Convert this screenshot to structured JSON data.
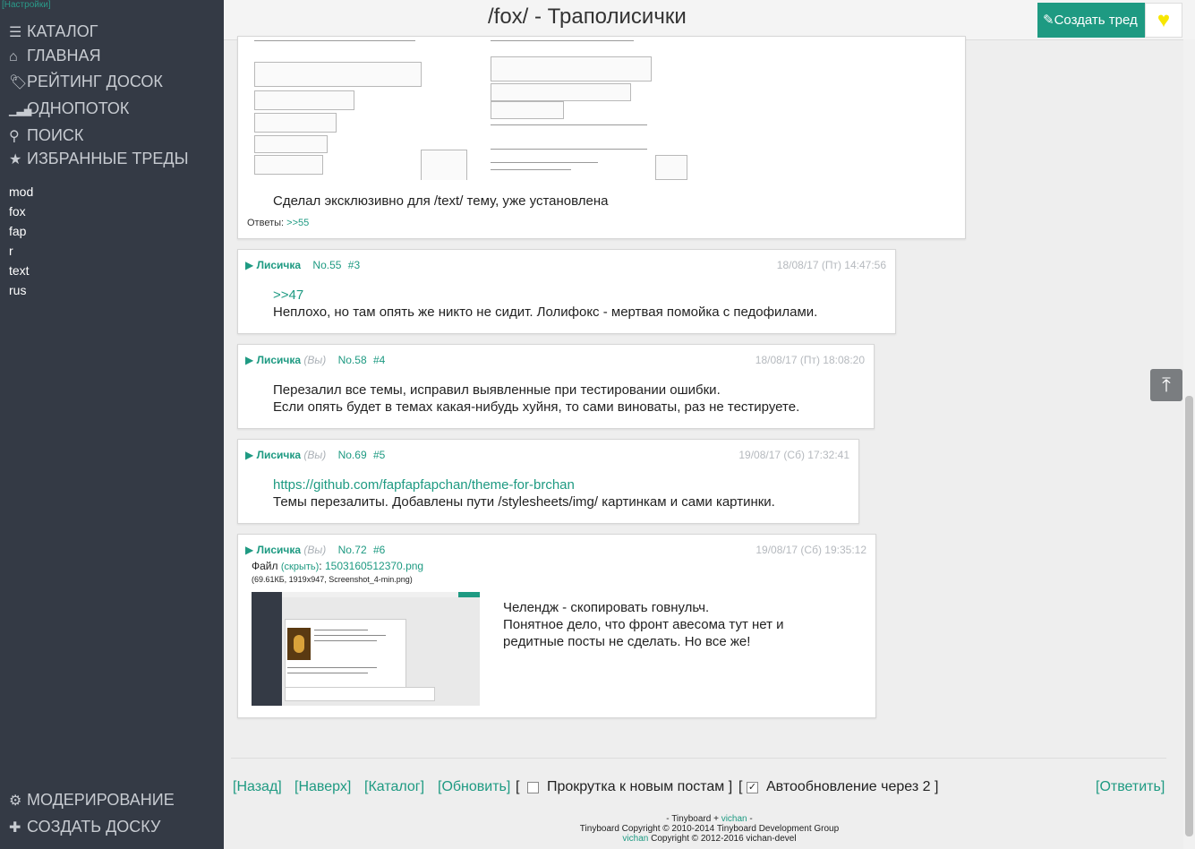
{
  "settings_link": "[Настройки]",
  "sidebar": {
    "nav": [
      {
        "icon": "☰",
        "label": "КАТАЛОГ"
      },
      {
        "icon": "⌂",
        "label": "ГЛАВНАЯ"
      },
      {
        "icon": "🏷",
        "label": "РЕЙТИНГ ДОСОК"
      },
      {
        "icon": "▁▃▅",
        "label": "ОДНОПОТОК"
      },
      {
        "icon": "⚲",
        "label": "ПОИСК"
      },
      {
        "icon": "★",
        "label": "ИЗБРАННЫЕ ТРЕДЫ"
      }
    ],
    "boards": [
      "mod",
      "fox",
      "fap",
      "r",
      "text",
      "rus"
    ],
    "bottom": [
      {
        "icon": "⚙",
        "label": "МОДЕРИРОВАНИЕ"
      },
      {
        "icon": "✚",
        "label": "СОЗДАТЬ ДОСКУ"
      }
    ]
  },
  "header": {
    "title": "/fox/ - Траполисички",
    "create_thread": "✎Создать тред",
    "fav_icon": "♥"
  },
  "posts": [
    {
      "text": "Сделал эксклюзивно для /text/ тему, уже установлена",
      "replies_label": "Ответы:",
      "replies_link": ">>55"
    },
    {
      "name": "Лисичка",
      "you": "",
      "no": "No.55",
      "num": "#3",
      "date": "18/08/17 (Пт) 14:47:56",
      "lines": [
        ">>47",
        "Неплохо, но там опять же никто не сидит. Лолифокс - мертвая помойка с педофилами."
      ]
    },
    {
      "name": "Лисичка",
      "you": "(Вы)",
      "no": "No.58",
      "num": "#4",
      "date": "18/08/17 (Пт) 18:08:20",
      "lines": [
        "Перезалил все темы, исправил выявленные при тестировании ошибки.",
        "Если опять будет в темах какая-нибудь хуйня, то сами виноваты, раз не тестируете."
      ]
    },
    {
      "name": "Лисичка",
      "you": "(Вы)",
      "no": "No.69",
      "num": "#5",
      "date": "19/08/17 (Сб) 17:32:41",
      "lines": [
        "https://github.com/fapfapfapchan/theme-for-brchan",
        "Темы перезалиты. Добавлены пути /stylesheets/img/ картинкам и сами картинки."
      ]
    },
    {
      "name": "Лисичка",
      "you": "(Вы)",
      "no": "No.72",
      "num": "#6",
      "date": "19/08/17 (Сб) 19:35:12",
      "file_label": "Файл",
      "file_hide": "(скрыть)",
      "file_name": "1503160512370.png",
      "file_info": "(69.61КБ, 1919x947, Screenshot_4-min.png)",
      "lines": [
        "Челендж - скопировать говнульч.",
        "Понятное дело, что фронт авесома тут нет и",
        "рeдитные посты не сделать. Но все же!"
      ]
    }
  ],
  "bottom_bar": {
    "back": "[Назад]",
    "top": "[Наверх]",
    "catalog": "[Каталог]",
    "refresh": "[Обновить]",
    "bracket_open": "[",
    "scroll_label": "Прокрутка к новым постам ]",
    "bracket_open2": "[",
    "auto_label": "Автообновление через 2 ]",
    "reply": "[Ответить]"
  },
  "footer": {
    "line1_a": "- Tinyboard +",
    "line1_b": "vichan",
    "line1_c": "-",
    "line2": "Tinyboard Copyright © 2010-2014 Tinyboard Development Group",
    "line3_a": "vichan",
    "line3_b": "Copyright © 2012-2016 vichan-devel"
  },
  "colors": {
    "accent": "#1e9a82",
    "sidebar": "#343a45",
    "fav": "#f7e600"
  }
}
